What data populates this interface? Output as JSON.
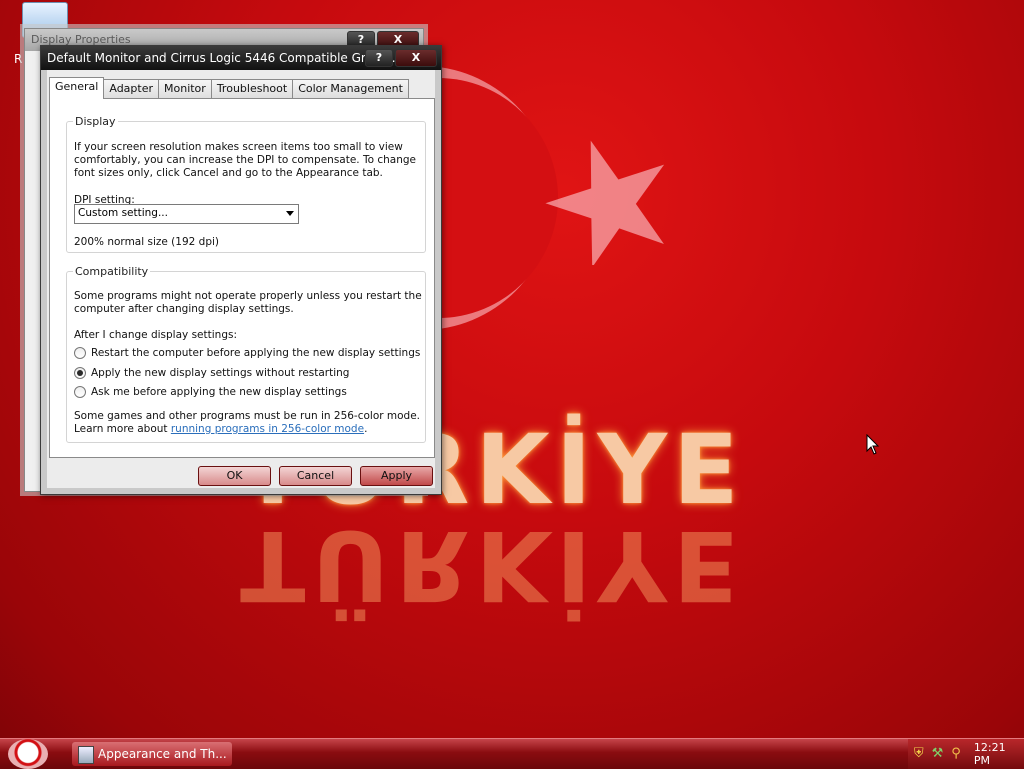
{
  "desktop": {
    "wallpaper_text": "TÜRKİYE",
    "icon_label": "R"
  },
  "background_window": {
    "title": "Display Properties",
    "help_label": "?",
    "close_label": "X"
  },
  "dialog": {
    "title": "Default Monitor and Cirrus Logic 5446 Compatible Graphi...",
    "help_label": "?",
    "close_label": "X",
    "tabs": [
      {
        "label": "General",
        "active": true
      },
      {
        "label": "Adapter"
      },
      {
        "label": "Monitor"
      },
      {
        "label": "Troubleshoot"
      },
      {
        "label": "Color Management"
      }
    ],
    "display_group": {
      "title": "Display",
      "description_lines": [
        "If your screen resolution makes screen items too small to view",
        "comfortably, you can increase the DPI to compensate.  To change",
        "font sizes only, click Cancel and go to the Appearance tab."
      ],
      "dpi_label": "DPI setting:",
      "dpi_value": "Custom setting...",
      "dpi_size": "200% normal size (192 dpi)"
    },
    "compat_group": {
      "title": "Compatibility",
      "description_lines": [
        "Some programs might not operate properly unless you restart the",
        "computer after changing display settings."
      ],
      "after_label": "After I change display settings:",
      "options": [
        {
          "label": "Restart the computer before applying the new display settings",
          "checked": false
        },
        {
          "label": "Apply the new display settings without restarting",
          "checked": true
        },
        {
          "label": "Ask me before applying the new display settings",
          "checked": false
        }
      ],
      "note_line1": "Some games and other programs must be run in 256-color mode.",
      "note_line2_prefix": "Learn more about ",
      "note_link": "running programs in 256-color mode",
      "note_line2_suffix": "."
    },
    "buttons": {
      "ok": "OK",
      "cancel": "Cancel",
      "apply": "Apply"
    }
  },
  "taskbar": {
    "task_label": "Appearance and Th...",
    "clock": "12:21 PM",
    "tray_icons": [
      "shield-icon",
      "network-icon",
      "search-icon"
    ]
  }
}
